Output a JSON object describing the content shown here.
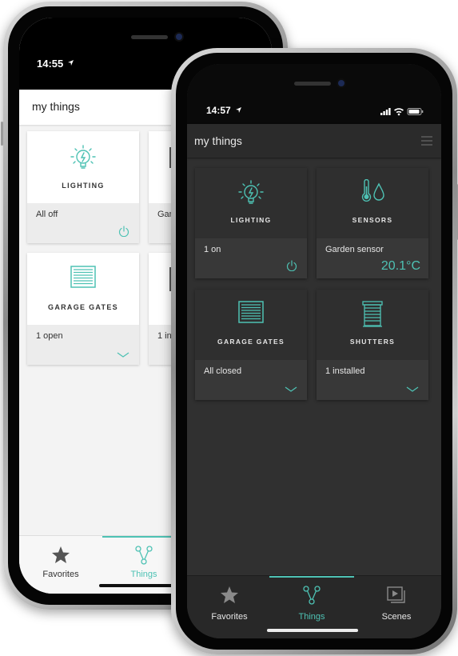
{
  "colors": {
    "accent": "#4ec2b4",
    "dark_bg": "#303030",
    "light_bg": "#f3f3f3"
  },
  "back_phone": {
    "status": {
      "time": "14:55"
    },
    "header": {
      "title": "my things"
    },
    "cards": [
      {
        "name": "LIGHTING",
        "status": "All off",
        "icon": "lightbulb-icon",
        "action": "power-icon"
      },
      {
        "name": "",
        "status": "Gar",
        "icon": "sensor-icon"
      },
      {
        "name": "GARAGE GATES",
        "status": "1 open",
        "icon": "garage-gate-icon",
        "action": "chevron-down-icon"
      },
      {
        "name": "",
        "status": "1 in",
        "icon": "shutter-icon"
      }
    ],
    "tabs": [
      {
        "label": "Favorites",
        "icon": "star-icon",
        "active": false
      },
      {
        "label": "Things",
        "icon": "things-icon",
        "active": true
      }
    ]
  },
  "front_phone": {
    "status": {
      "time": "14:57",
      "icons": [
        "signal-icon",
        "wifi-icon",
        "battery-icon"
      ]
    },
    "header": {
      "title": "my things",
      "menu_icon": "menu-icon"
    },
    "cards": [
      {
        "name": "LIGHTING",
        "status": "1 on",
        "icon": "lightbulb-icon",
        "action": "power-icon"
      },
      {
        "name": "SENSORS",
        "status": "Garden sensor",
        "value": "20.1°C",
        "icon": "thermometer-droplet-icon"
      },
      {
        "name": "GARAGE GATES",
        "status": "All closed",
        "icon": "garage-gate-icon",
        "action": "chevron-down-icon"
      },
      {
        "name": "SHUTTERS",
        "status": "1 installed",
        "icon": "shutter-icon",
        "action": "chevron-down-icon"
      }
    ],
    "tabs": [
      {
        "label": "Favorites",
        "icon": "star-icon",
        "active": false
      },
      {
        "label": "Things",
        "icon": "things-icon",
        "active": true
      },
      {
        "label": "Scenes",
        "icon": "scenes-icon",
        "active": false
      }
    ]
  }
}
